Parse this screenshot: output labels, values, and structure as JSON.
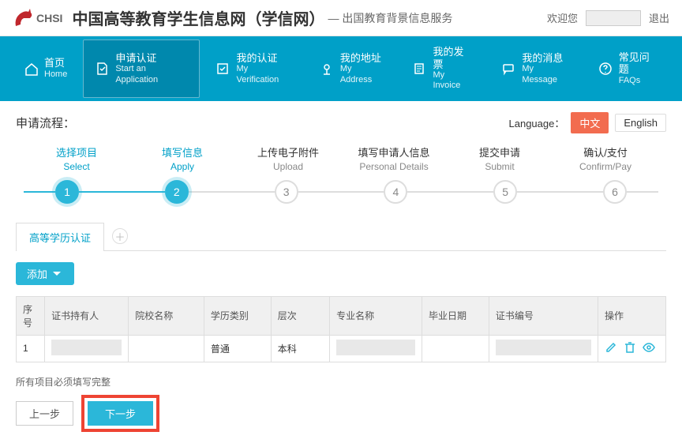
{
  "header": {
    "logo_text": "CHSI",
    "site_title": "中国高等教育学生信息网（学信网）",
    "site_sub": "— 出国教育背景信息服务",
    "welcome": "欢迎您",
    "logout": "退出"
  },
  "nav": [
    {
      "cn": "首页",
      "en": "Home",
      "icon": "home"
    },
    {
      "cn": "申请认证",
      "en": "Start an Application",
      "icon": "apply",
      "active": true
    },
    {
      "cn": "我的认证",
      "en": "My Verification",
      "icon": "verify"
    },
    {
      "cn": "我的地址",
      "en": "My Address",
      "icon": "address"
    },
    {
      "cn": "我的发票",
      "en": "My Invoice",
      "icon": "invoice"
    },
    {
      "cn": "我的消息",
      "en": "My Message",
      "icon": "message"
    },
    {
      "cn": "常见问题",
      "en": "FAQs",
      "icon": "faq"
    }
  ],
  "flow": {
    "title": "申请流程：",
    "lang_label": "Language：",
    "lang_cn": "中文",
    "lang_en": "English"
  },
  "steps": [
    {
      "cn": "选择项目",
      "en": "Select",
      "state": "active"
    },
    {
      "cn": "填写信息",
      "en": "Apply",
      "state": "active"
    },
    {
      "cn": "上传电子附件",
      "en": "Upload",
      "state": ""
    },
    {
      "cn": "填写申请人信息",
      "en": "Personal Details",
      "state": ""
    },
    {
      "cn": "提交申请",
      "en": "Submit",
      "state": ""
    },
    {
      "cn": "确认/支付",
      "en": "Confirm/Pay",
      "state": ""
    }
  ],
  "tabs": {
    "main": "高等学历认证"
  },
  "buttons": {
    "add": "添加",
    "prev": "上一步",
    "next": "下一步"
  },
  "table": {
    "headers": {
      "idx": "序号",
      "holder": "证书持有人",
      "school": "院校名称",
      "type": "学历类别",
      "level": "层次",
      "major": "专业名称",
      "grad": "毕业日期",
      "cert": "证书编号",
      "ops": "操作"
    },
    "row": {
      "idx": "1",
      "holder": "",
      "school": "",
      "type": "普通",
      "level": "本科",
      "major": "",
      "grad": "",
      "cert": ""
    }
  },
  "note": "所有项目必须填写完整"
}
